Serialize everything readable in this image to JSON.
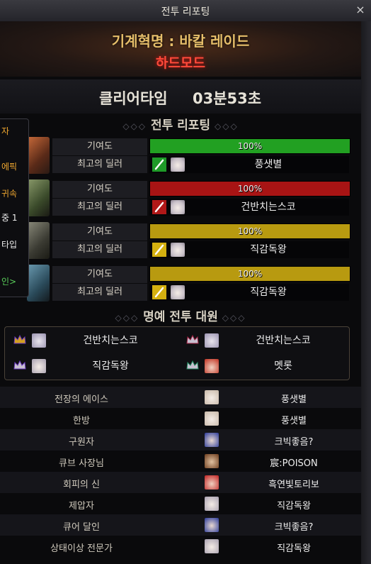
{
  "window": {
    "title": "전투 리포팅",
    "close_glyph": "×"
  },
  "raid": {
    "name": "기계혁명 : 바칼 레이드",
    "mode": "하드모드"
  },
  "clear": {
    "label": "클리어타임",
    "time": "03분53초"
  },
  "sections": {
    "report_title": "전투 리포팅",
    "honor_title": "명예 전투 대원"
  },
  "report_rows": [
    {
      "contrib_label": "기여도",
      "percent": "100%",
      "bar_color": "#22a022",
      "dealer_label": "최고의 딜러",
      "weapon_color": "#1e9a28",
      "dealer_name": "풍샛별"
    },
    {
      "contrib_label": "기여도",
      "percent": "100%",
      "bar_color": "#a81414",
      "dealer_label": "최고의 딜러",
      "weapon_color": "#b01818",
      "dealer_name": "건반치는스코"
    },
    {
      "contrib_label": "기여도",
      "percent": "100%",
      "bar_color": "#b89a10",
      "dealer_label": "최고의 딜러",
      "weapon_color": "#d4b010",
      "dealer_name": "직감독왕"
    },
    {
      "contrib_label": "기여도",
      "percent": "100%",
      "bar_color": "#b89a10",
      "dealer_label": "최고의 딜러",
      "weapon_color": "#d4b010",
      "dealer_name": "직감독왕"
    }
  ],
  "honor": [
    {
      "name": "건반치는스코"
    },
    {
      "name": "건반치는스코"
    },
    {
      "name": "직감독왕"
    },
    {
      "name": "멧롯"
    }
  ],
  "awards": [
    {
      "title": "전장의 에이스",
      "name": "풍샛별"
    },
    {
      "title": "한방",
      "name": "풍샛별"
    },
    {
      "title": "구원자",
      "name": "크빅좋음?"
    },
    {
      "title": "큐브 사장님",
      "name": "宸:POISON"
    },
    {
      "title": "회피의 신",
      "name": "흑연빛토리보"
    },
    {
      "title": "제압자",
      "name": "직감독왕"
    },
    {
      "title": "큐어 달인",
      "name": "크빅좋음?"
    },
    {
      "title": "상태이상 전문가",
      "name": "직감독왕"
    }
  ],
  "side_panel": [
    "자",
    "에픽",
    "귀속",
    "중 1",
    "타입",
    "인>"
  ],
  "colors": {
    "accent_gold": "#e6be6a",
    "hard_mode_red": "#ff4a3a"
  }
}
